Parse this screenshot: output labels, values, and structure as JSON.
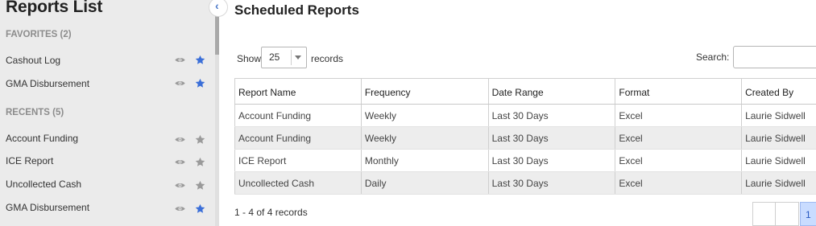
{
  "sidebar": {
    "title": "Reports List",
    "favorites_header": "FAVORITES (2)",
    "recents_header": "RECENTS (5)",
    "favorites": [
      {
        "label": "Cashout Log",
        "starred": true
      },
      {
        "label": "GMA Disbursement",
        "starred": true
      }
    ],
    "recents": [
      {
        "label": "Account Funding",
        "starred": false
      },
      {
        "label": "ICE Report",
        "starred": false
      },
      {
        "label": "Uncollected Cash",
        "starred": false
      },
      {
        "label": "GMA Disbursement",
        "starred": true
      }
    ],
    "collapse_glyph": "‹"
  },
  "colors": {
    "star_active": "#3b6fd8",
    "star_inactive": "#9a9a9a",
    "eye": "#9a9a9a"
  },
  "main": {
    "title": "Scheduled Reports",
    "show_label": "Show",
    "page_length": "25",
    "records_label": "records",
    "search_label": "Search:",
    "search_value": ""
  },
  "table": {
    "columns": [
      "Report Name",
      "Frequency",
      "Date Range",
      "Format",
      "Created By"
    ],
    "rows": [
      [
        "Account Funding",
        "Weekly",
        "Last 30 Days",
        "Excel",
        "Laurie Sidwell"
      ],
      [
        "Account Funding",
        "Weekly",
        "Last 30 Days",
        "Excel",
        "Laurie Sidwell"
      ],
      [
        "ICE Report",
        "Monthly",
        "Last 30 Days",
        "Excel",
        "Laurie Sidwell"
      ],
      [
        "Uncollected Cash",
        "Daily",
        "Last 30 Days",
        "Excel",
        "Laurie Sidwell"
      ]
    ]
  },
  "footer": {
    "info": "1 - 4 of 4 records",
    "current_page": "1"
  }
}
